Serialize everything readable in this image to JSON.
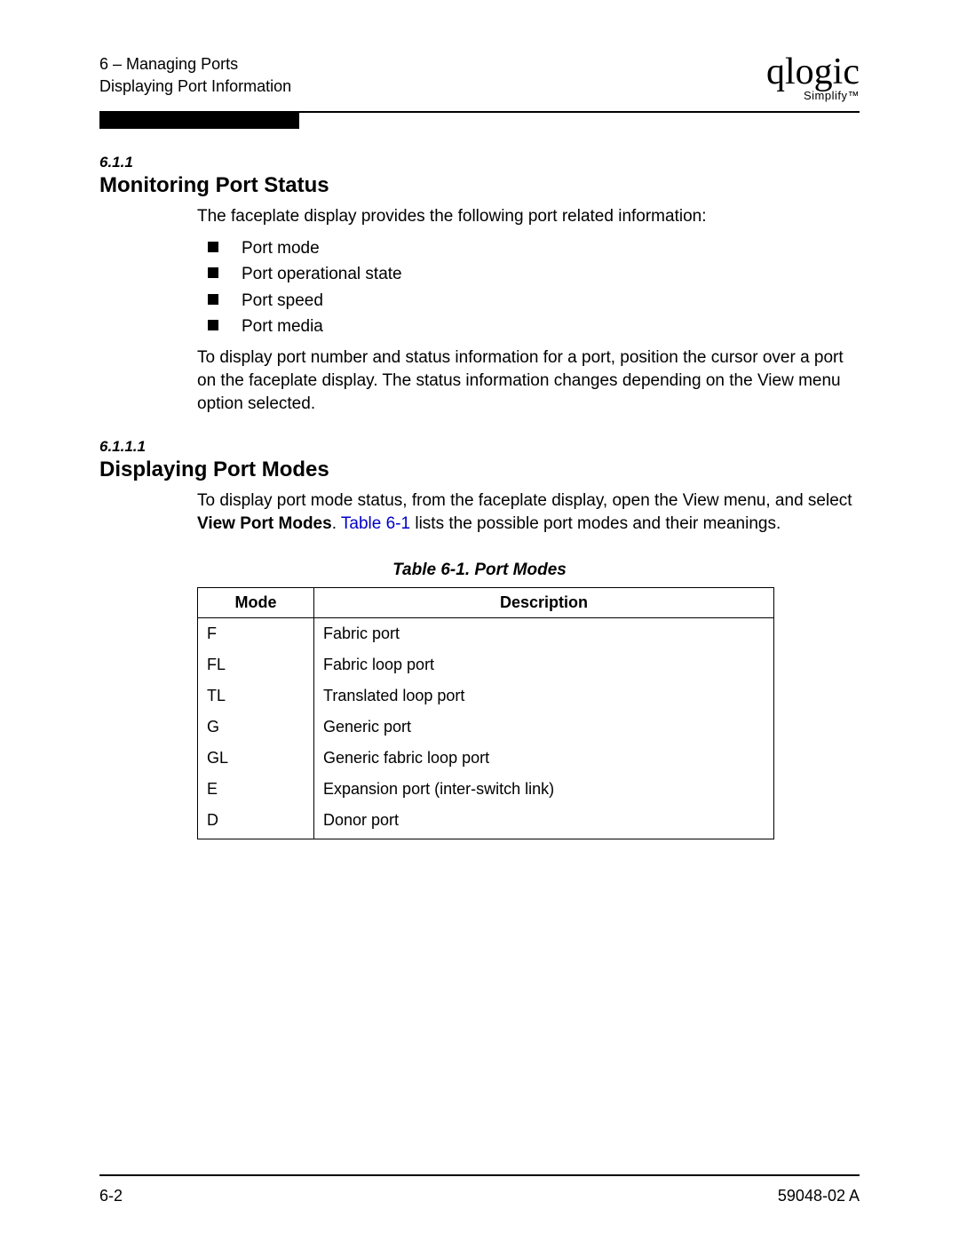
{
  "header": {
    "chapter_line": "6 – Managing Ports",
    "subtitle_line": "Displaying Port Information",
    "logo_name": "qlogic",
    "logo_sub": "Simplify™"
  },
  "section1": {
    "num": "6.1.1",
    "title": "Monitoring Port Status",
    "intro": "The faceplate display provides the following port related information:",
    "bullets": [
      "Port mode",
      "Port operational state",
      "Port speed",
      "Port media"
    ],
    "outro": "To display port number and status information for a port, position the cursor over a port on the faceplate display. The status information changes depending on the View menu option selected."
  },
  "section2": {
    "num": "6.1.1.1",
    "title": "Displaying Port Modes",
    "para_pre": "To display port mode status, from the faceplate display, open the View menu, and select ",
    "para_bold": "View Port Modes",
    "para_mid": ". ",
    "para_link": "Table 6-1",
    "para_post": " lists the possible port modes and their meanings."
  },
  "table": {
    "caption": "Table 6-1. Port Modes",
    "headers": {
      "c1": "Mode",
      "c2": "Description"
    },
    "rows": [
      {
        "mode": "F",
        "desc": "Fabric port"
      },
      {
        "mode": "FL",
        "desc": "Fabric loop port"
      },
      {
        "mode": "TL",
        "desc": "Translated loop port"
      },
      {
        "mode": "G",
        "desc": "Generic port"
      },
      {
        "mode": "GL",
        "desc": "Generic fabric loop port"
      },
      {
        "mode": "E",
        "desc": "Expansion port (inter-switch link)"
      },
      {
        "mode": "D",
        "desc": "Donor port"
      }
    ]
  },
  "footer": {
    "page": "6-2",
    "docid": "59048-02  A"
  }
}
